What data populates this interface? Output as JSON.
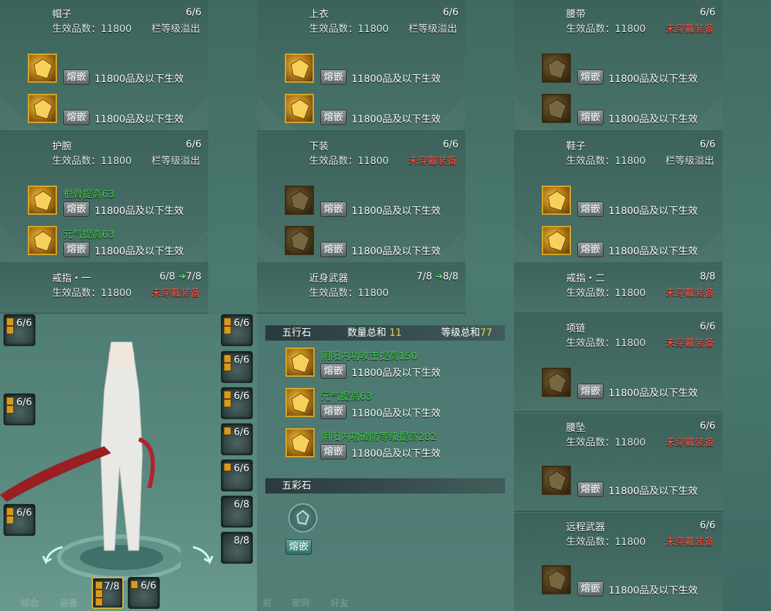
{
  "labels": {
    "effect_prefix": "生效品数：",
    "inlay": "熔嵌",
    "below_effect": "11800品及以下生效"
  },
  "panels": {
    "hat": {
      "title": "帽子",
      "count": "6/6",
      "eff": "11800",
      "status": "栏等级溢出"
    },
    "top": {
      "title": "上衣",
      "count": "6/6",
      "eff": "11800",
      "status": "栏等级溢出"
    },
    "belt": {
      "title": "腰带",
      "count": "6/6",
      "eff": "11800",
      "status": "未穿戴装备"
    },
    "wrist": {
      "title": "护腕",
      "count": "6/6",
      "eff": "11800",
      "status": "栏等级溢出",
      "bonus1": "根骨提高63",
      "bonus2": "元气提高63"
    },
    "pants": {
      "title": "下装",
      "count": "6/6",
      "eff": "11800",
      "status": "未穿戴装备"
    },
    "shoes": {
      "title": "鞋子",
      "count": "6/6",
      "eff": "11800",
      "status": "栏等级溢出"
    },
    "ring1": {
      "title": "戒指・一",
      "count_from": "6/8",
      "count_to": "7/8",
      "eff": "11800",
      "status": "未穿戴装备"
    },
    "melee": {
      "title": "近身武器",
      "count_from": "7/8",
      "count_to": "8/8",
      "eff": "11800"
    },
    "ring2": {
      "title": "戒指・二",
      "count": "8/8",
      "eff": "11800",
      "status": "未穿戴装备"
    },
    "necklace": {
      "title": "项链",
      "count": "6/6",
      "eff": "11800",
      "status": "未穿戴装备"
    },
    "pendant": {
      "title": "腰坠",
      "count": "6/6",
      "eff": "11800",
      "status": "未穿戴装备"
    },
    "ranged": {
      "title": "远程武器",
      "count": "6/6",
      "eff": "11800",
      "status": "未穿戴装备"
    }
  },
  "wuxing": {
    "title": "五行石",
    "qty_label": "数量总和",
    "qty": "11",
    "lvl_label": "等级总和",
    "lvl": "77",
    "items": [
      "阴阳内功攻击提高150",
      "元气提高63",
      "阴阳内功破防等级提高282"
    ]
  },
  "wucai": {
    "title": "五彩石",
    "button": "熔嵌"
  },
  "slots": {
    "left": [
      "6/6",
      "6/6",
      "6/6"
    ],
    "right": [
      "6/6",
      "6/6",
      "6/6",
      "6/6",
      "6/6",
      "6/8",
      "8/8"
    ],
    "bottom": [
      "7/8",
      "6/6"
    ]
  },
  "footer_tabs": [
    "综合",
    "装备",
    "前",
    "密网",
    "好友"
  ]
}
